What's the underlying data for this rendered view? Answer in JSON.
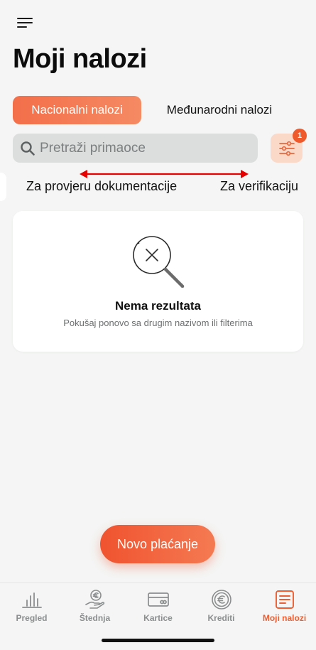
{
  "header": {
    "title": "Moji nalozi"
  },
  "tabs": [
    {
      "label": "Nacionalni nalozi",
      "active": true
    },
    {
      "label": "Međunarodni nalozi",
      "active": false
    }
  ],
  "search": {
    "placeholder": "Pretraži primaoce"
  },
  "filter": {
    "badge_count": "1"
  },
  "sub_tabs": [
    {
      "label": "Za provjeru dokumentacije"
    },
    {
      "label": "Za verifikaciju"
    }
  ],
  "empty_state": {
    "title": "Nema rezultata",
    "subtitle": "Pokušaj ponovo sa drugim nazivom ili filterima",
    "icon": "search-no-results-icon"
  },
  "actions": {
    "new_payment": "Novo plaćanje"
  },
  "bottom_nav": [
    {
      "label": "Pregled",
      "icon": "bar-chart-icon",
      "active": false
    },
    {
      "label": "Štednja",
      "icon": "savings-hand-icon",
      "active": false
    },
    {
      "label": "Kartice",
      "icon": "card-icon",
      "active": false
    },
    {
      "label": "Krediti",
      "icon": "euro-coin-icon",
      "active": false
    },
    {
      "label": "Moji nalozi",
      "icon": "document-list-icon",
      "active": true
    }
  ],
  "colors": {
    "accent": "#f36f4a",
    "accent_dark": "#ea5f34",
    "background": "#f4f5f4",
    "arrow": "#e60000"
  }
}
